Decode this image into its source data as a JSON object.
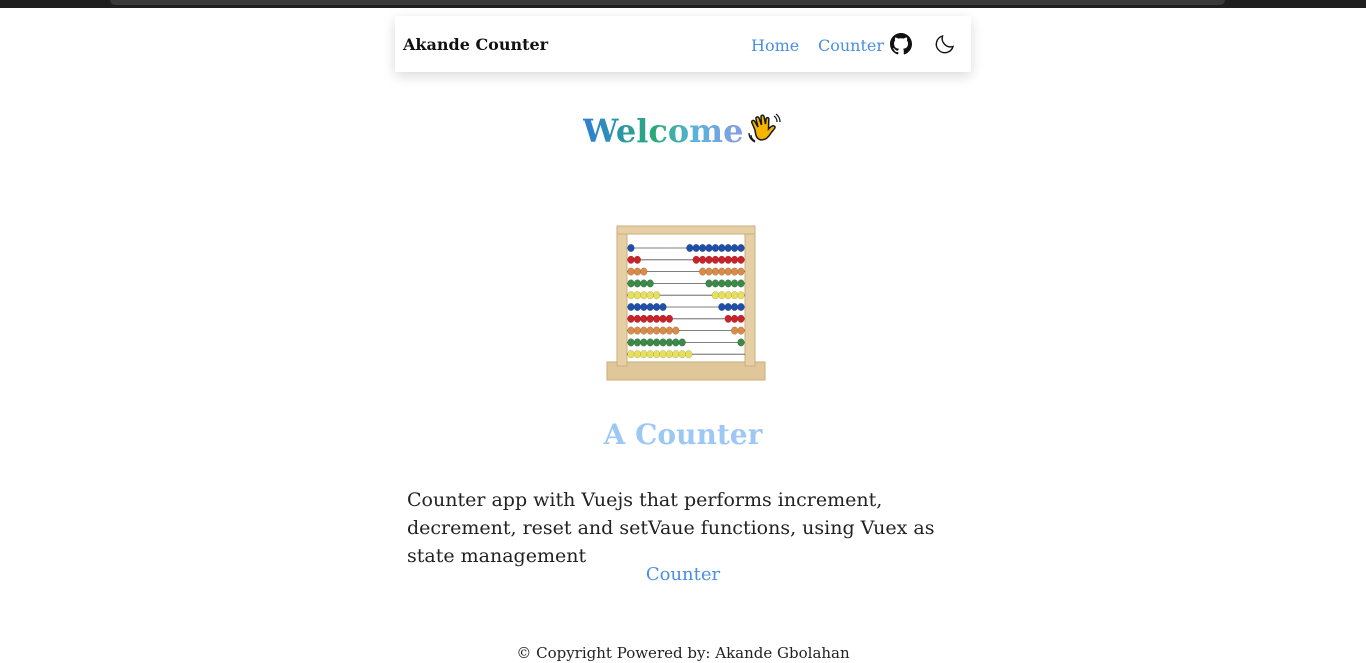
{
  "nav": {
    "brand": "Akande Counter",
    "links": [
      "Home",
      "Counter"
    ],
    "icons": [
      "github-icon",
      "moon-icon"
    ]
  },
  "hero": {
    "title": "Welcome",
    "emoji": "waving-hand-icon"
  },
  "image": {
    "name": "abacus-illustration",
    "bead_colors": [
      "#1f4fa8",
      "#c8232a",
      "#d98b4a",
      "#3c8a4a",
      "#e8e05a"
    ]
  },
  "content": {
    "subtitle": "A Counter",
    "description": "Counter app with Vuejs that performs increment, decrement, reset and setVaue functions, using Vuex as state management",
    "link": "Counter"
  },
  "footer": {
    "text": "© Copyright Powered by: Akande Gbolahan"
  },
  "colors": {
    "link": "#4a8fe0",
    "subtitle": "#9ec8f4"
  }
}
